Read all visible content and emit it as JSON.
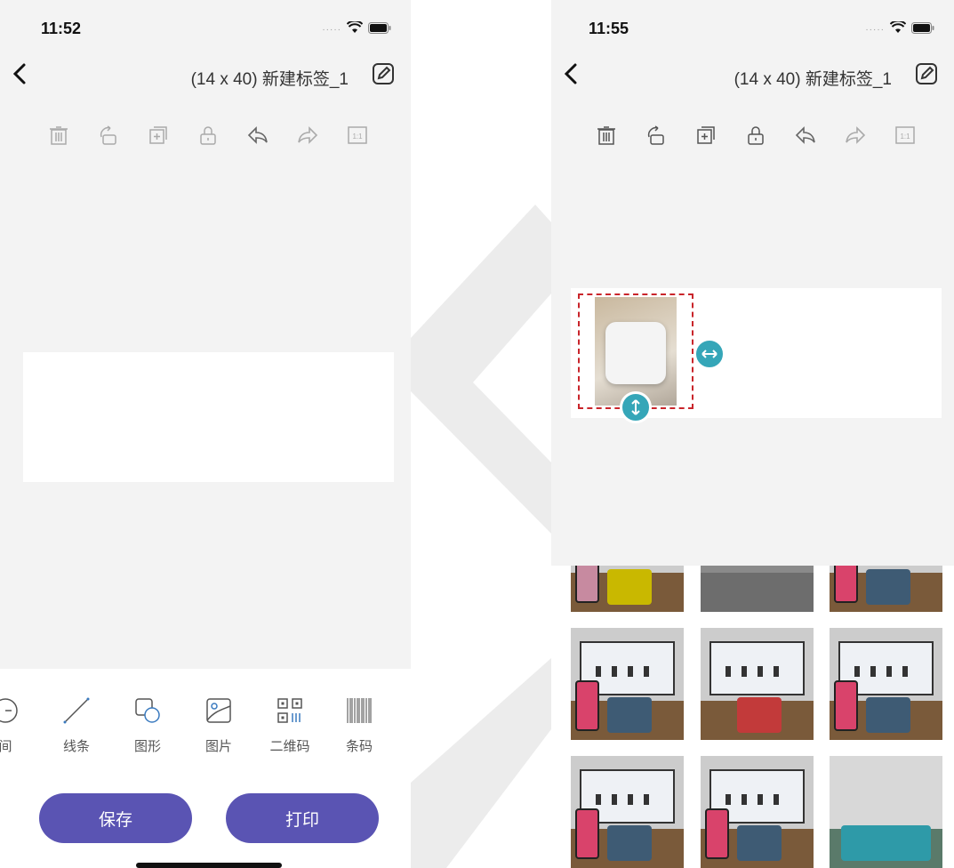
{
  "left_screen": {
    "status": {
      "time": "11:52"
    },
    "nav": {
      "title": "(14 x 40) 新建标签_1"
    },
    "widgets": [
      {
        "label": "间",
        "icon": "time-icon"
      },
      {
        "label": "线条",
        "icon": "line-icon"
      },
      {
        "label": "图形",
        "icon": "shape-icon"
      },
      {
        "label": "图片",
        "icon": "image-icon"
      },
      {
        "label": "二维码",
        "icon": "qrcode-icon"
      },
      {
        "label": "条码",
        "icon": "barcode-icon"
      }
    ],
    "buttons": {
      "save": "保存",
      "print": "打印"
    }
  },
  "right_screen": {
    "status": {
      "time": "11:55"
    },
    "nav": {
      "title": "(14 x 40) 新建标签_1"
    }
  },
  "toolbar_icons": [
    "delete-icon",
    "rotate-icon",
    "duplicate-icon",
    "lock-icon",
    "undo-icon",
    "redo-icon",
    "actual-size-icon"
  ],
  "toolbar_actual_size_text": "1:1",
  "colors": {
    "accent": "#5a54b3",
    "handle": "#35a6b8",
    "selection": "#c9252b"
  }
}
